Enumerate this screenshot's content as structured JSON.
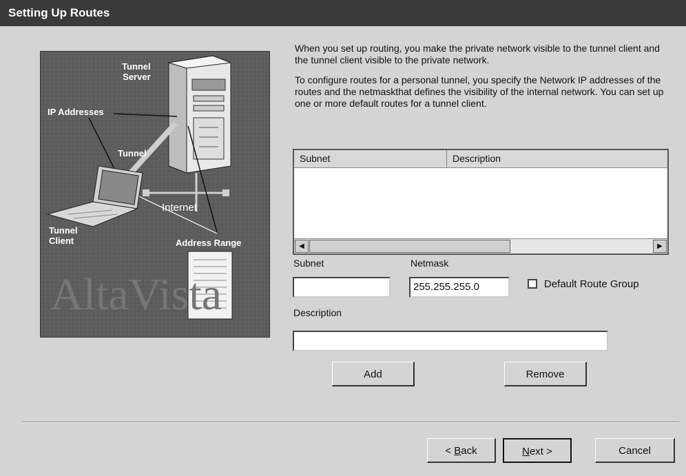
{
  "window": {
    "title": "Setting Up Routes"
  },
  "illustration": {
    "labels": {
      "tunnel_server": [
        "Tunnel",
        "Server"
      ],
      "ip_addresses": "IP Addresses",
      "tunnel": "Tunnel",
      "internet": "Internet",
      "tunnel_client": [
        "Tunnel",
        "Client"
      ],
      "address_range": "Address Range"
    },
    "watermark": "AltaVista"
  },
  "intro": {
    "paragraph1": "When you set up routing, you make the private network visible to the tunnel client and the tunnel client visible to the private network.",
    "paragraph2": "To configure routes for a personal tunnel, you specify the Network IP addresses of the routes and the netmaskthat defines the visibility of the internal network.  You can set up one or more default routes for a tunnel client."
  },
  "routes_list": {
    "columns": [
      "Subnet",
      "Description"
    ],
    "rows": []
  },
  "form": {
    "subnet_label": "Subnet",
    "subnet_value": "",
    "netmask_label": "Netmask",
    "netmask_value": "255.255.255.0",
    "default_route_label": "Default Route Group",
    "default_route_checked": false,
    "description_label": "Description",
    "description_value": ""
  },
  "actions": {
    "add": "Add",
    "remove": "Remove"
  },
  "footer": {
    "back_prefix": "< ",
    "back_mnemonic": "B",
    "back_rest": "ack",
    "next_mnemonic": "N",
    "next_rest": "ext >",
    "cancel": "Cancel"
  },
  "colors": {
    "titlebar": "#3a3a3a",
    "dialog_bg": "#d4d4d4",
    "illustration_bg": "#5f5f5f"
  }
}
